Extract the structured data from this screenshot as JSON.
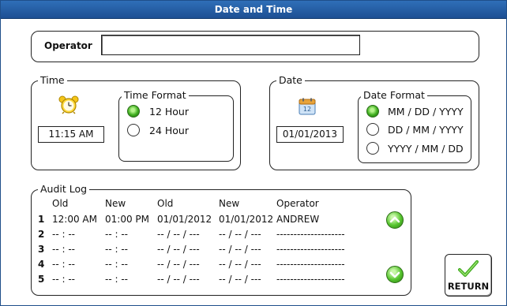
{
  "window": {
    "title": "Date and Time"
  },
  "operator": {
    "label": "Operator",
    "value": "",
    "placeholder": ""
  },
  "time": {
    "legend": "Time",
    "icon": "alarm-clock-icon",
    "value": "11:15 AM",
    "format": {
      "legend": "Time Format",
      "options": [
        {
          "label": "12 Hour",
          "selected": true
        },
        {
          "label": "24 Hour",
          "selected": false
        }
      ]
    }
  },
  "date": {
    "legend": "Date",
    "icon": "calendar-icon",
    "icon_text": "12",
    "value": "01/01/2013",
    "format": {
      "legend": "Date Format",
      "options": [
        {
          "label": "MM / DD / YYYY",
          "selected": true
        },
        {
          "label": "DD / MM / YYYY",
          "selected": false
        },
        {
          "label": "YYYY / MM / DD",
          "selected": false
        }
      ]
    }
  },
  "audit": {
    "legend": "Audit Log",
    "headers": [
      "Old",
      "New",
      "Old",
      "New",
      "Operator"
    ],
    "rows": [
      {
        "num": "1",
        "old_time": "12:00 AM",
        "new_time": "01:00 PM",
        "old_date": "01/01/2012",
        "new_date": "01/01/2012",
        "operator": "ANDREW"
      },
      {
        "num": "2",
        "old_time": "-- : --",
        "new_time": "-- : --",
        "old_date": "-- / -- / ---",
        "new_date": "-- / -- / ---",
        "operator": "--------------------"
      },
      {
        "num": "3",
        "old_time": "-- : --",
        "new_time": "-- : --",
        "old_date": "-- / -- / ---",
        "new_date": "-- / -- / ---",
        "operator": "--------------------"
      },
      {
        "num": "4",
        "old_time": "-- : --",
        "new_time": "-- : --",
        "old_date": "-- / -- / ---",
        "new_date": "-- / -- / ---",
        "operator": "--------------------"
      },
      {
        "num": "5",
        "old_time": "-- : --",
        "new_time": "-- : --",
        "old_date": "-- / -- / ---",
        "new_date": "-- / -- / ---",
        "operator": "--------------------"
      }
    ],
    "scroll_up_icon": "chevron-up-icon",
    "scroll_down_icon": "chevron-down-icon"
  },
  "return_button": {
    "label": "RETURN",
    "icon": "checkmark-icon"
  },
  "colors": {
    "title_bar": "#1d4f93",
    "radio_selected": "#3fae1f",
    "scroll_button": "#55c42d"
  }
}
